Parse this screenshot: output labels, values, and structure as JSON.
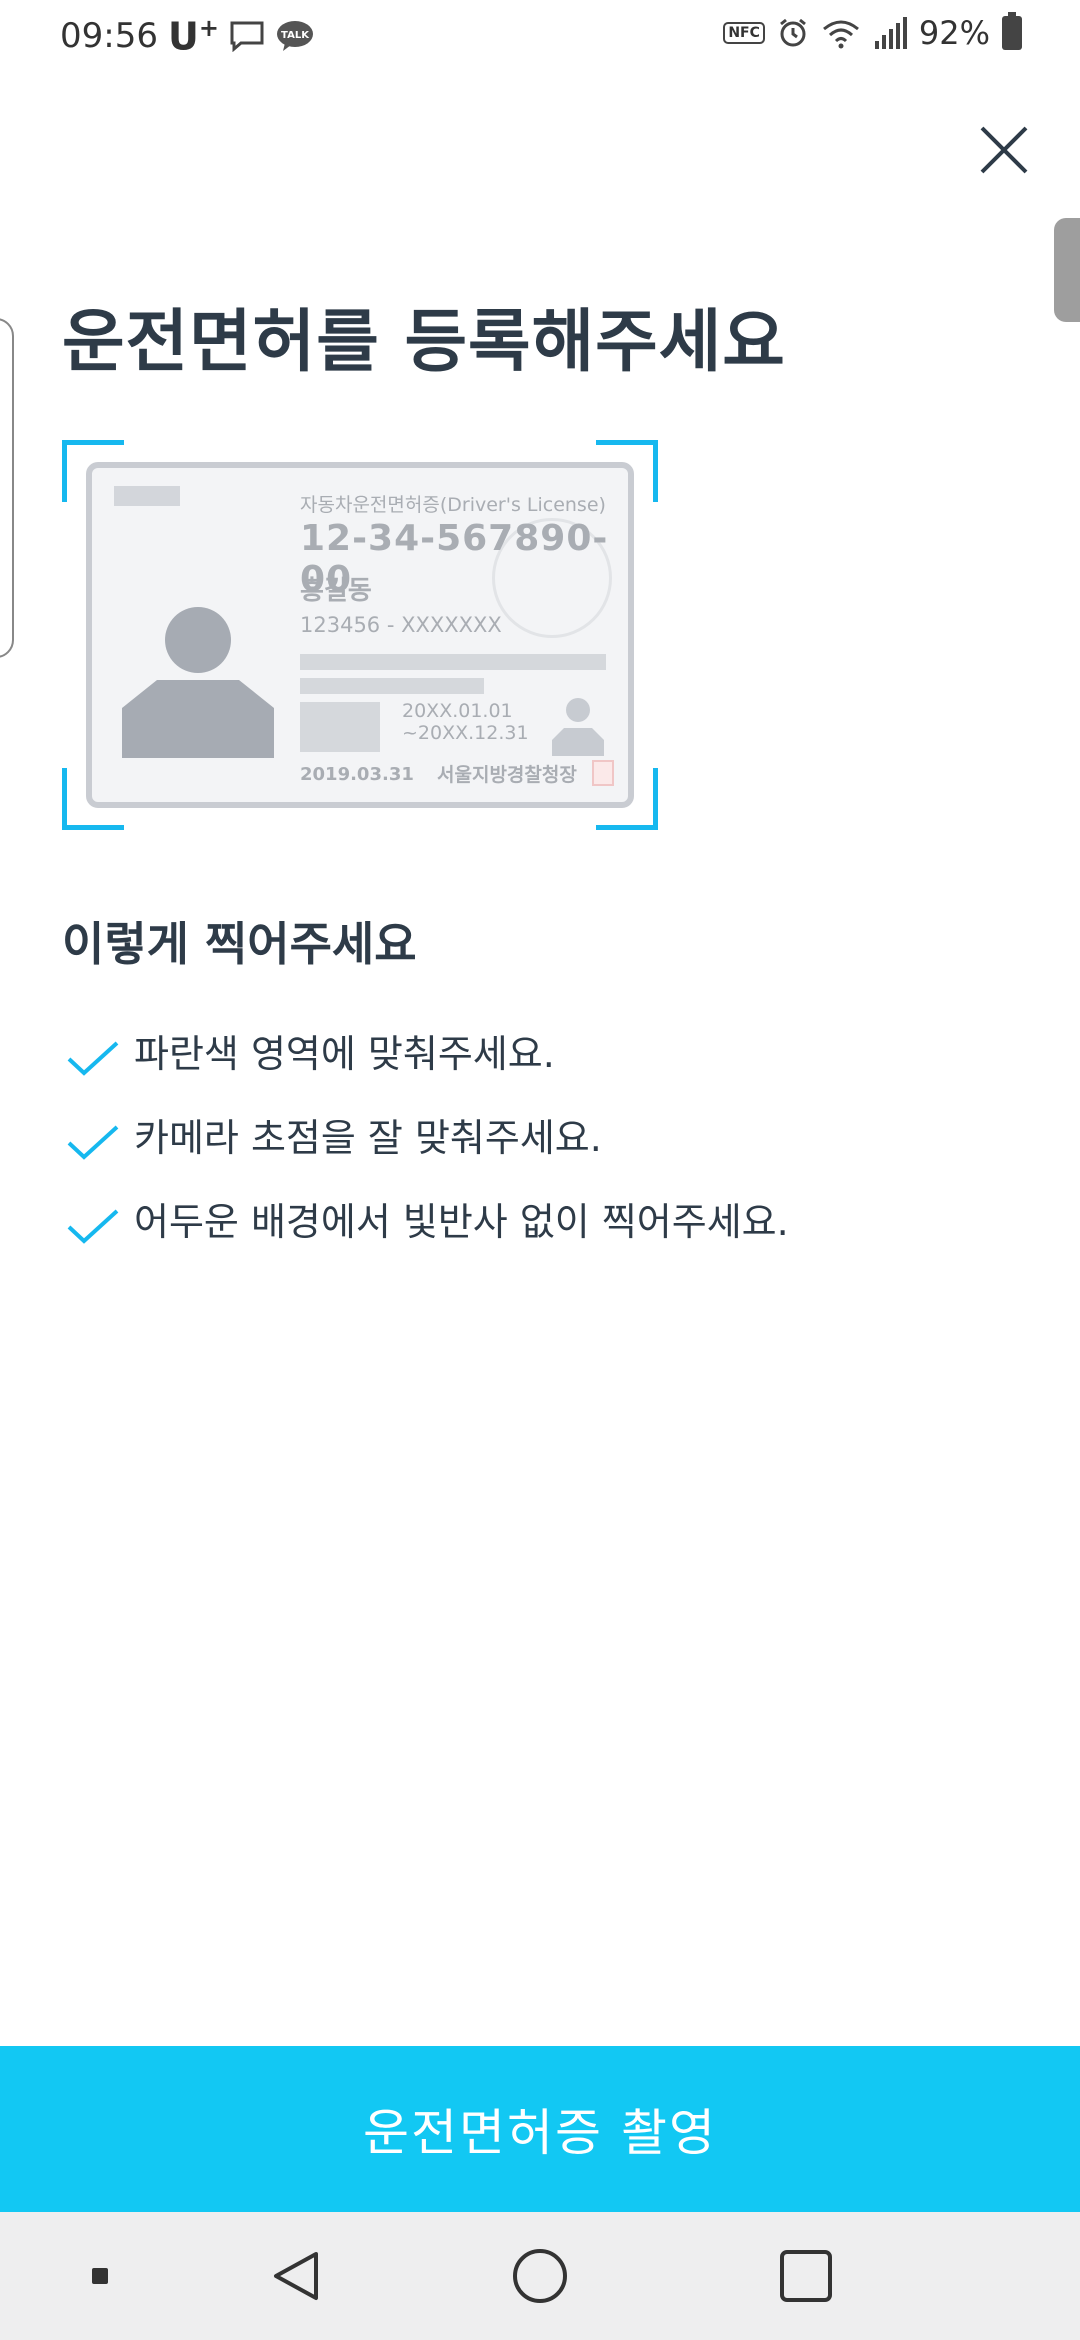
{
  "status_bar": {
    "time": "09:56",
    "carrier": "U",
    "carrier_sup": "+",
    "talk_badge": "TALK",
    "nfc": "NFC",
    "battery": "92%"
  },
  "page": {
    "title": "운전면허를 등록해주세요"
  },
  "license_card": {
    "header": "자동차운전면허증(Driver's License)",
    "number": "12-34-567890-00",
    "name": "홍길동",
    "id_number": "123456 - XXXXXXX",
    "validity_start": "20XX.01.01",
    "validity_end": "~20XX.12.31",
    "issue_date": "2019.03.31",
    "issuer": "서울지방경찰청장"
  },
  "instructions": {
    "title": "이렇게 찍어주세요",
    "items": [
      "파란색 영역에 맞춰주세요.",
      "카메라 초점을 잘 맞춰주세요.",
      "어두운 배경에서 빛반사 없이 찍어주세요."
    ]
  },
  "capture_button": {
    "label": "운전면허증 촬영"
  },
  "colors": {
    "accent": "#12c8f3",
    "frame": "#16b8ef",
    "text": "#2e3b48",
    "nav_bg": "#eeeeef"
  },
  "icons": {
    "close": "close-icon",
    "check": "check-icon",
    "back": "nav-back-icon",
    "home": "nav-home-icon",
    "recents": "nav-recents-icon"
  }
}
